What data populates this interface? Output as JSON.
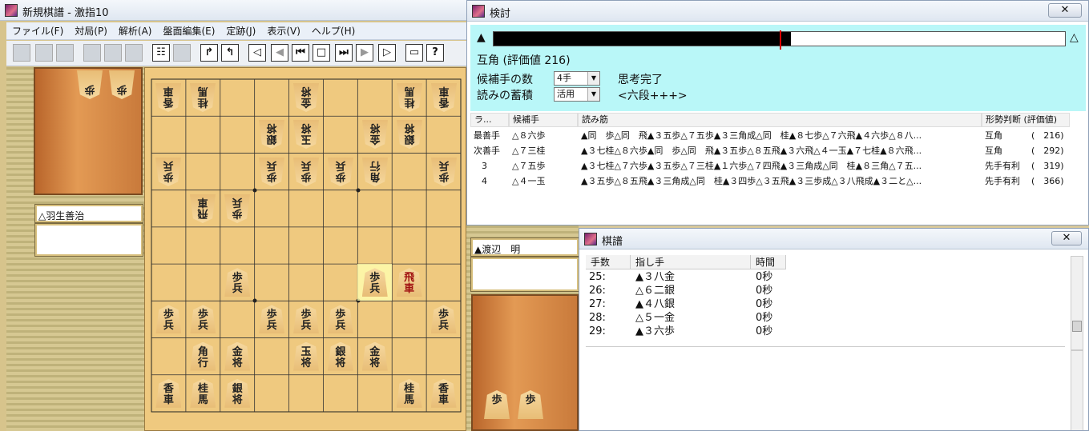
{
  "main_window": {
    "title": "新規棋譜 - 激指10",
    "menu": [
      "ファイル(F)",
      "対局(P)",
      "解析(A)",
      "盤面編集(E)",
      "定跡(J)",
      "表示(V)",
      "ヘルプ(H)"
    ]
  },
  "players": {
    "gote_name": "△羽生善治",
    "sente_name": "▲渡辺　明"
  },
  "gote_hand": [
    "歩",
    "歩"
  ],
  "sente_hand": [
    "歩",
    "歩"
  ],
  "board": {
    "gote": [
      {
        "r": 0,
        "c": 0,
        "t": "香車"
      },
      {
        "r": 0,
        "c": 1,
        "t": "桂馬"
      },
      {
        "r": 0,
        "c": 4,
        "t": "金将"
      },
      {
        "r": 0,
        "c": 7,
        "t": "桂馬"
      },
      {
        "r": 0,
        "c": 8,
        "t": "香車"
      },
      {
        "r": 1,
        "c": 3,
        "t": "銀将"
      },
      {
        "r": 1,
        "c": 4,
        "t": "玉将"
      },
      {
        "r": 1,
        "c": 6,
        "t": "金将"
      },
      {
        "r": 1,
        "c": 7,
        "t": "銀将"
      },
      {
        "r": 2,
        "c": 0,
        "t": "歩兵"
      },
      {
        "r": 2,
        "c": 3,
        "t": "歩兵"
      },
      {
        "r": 2,
        "c": 4,
        "t": "歩兵"
      },
      {
        "r": 2,
        "c": 5,
        "t": "歩兵"
      },
      {
        "r": 2,
        "c": 6,
        "t": "角行"
      },
      {
        "r": 2,
        "c": 8,
        "t": "歩兵"
      },
      {
        "r": 3,
        "c": 1,
        "t": "飛車"
      },
      {
        "r": 3,
        "c": 2,
        "t": "歩兵"
      }
    ],
    "sente": [
      {
        "r": 5,
        "c": 2,
        "t": "歩兵"
      },
      {
        "r": 5,
        "c": 6,
        "t": "歩兵",
        "hl": true
      },
      {
        "r": 5,
        "c": 7,
        "t": "飛車",
        "red": true
      },
      {
        "r": 6,
        "c": 0,
        "t": "歩兵"
      },
      {
        "r": 6,
        "c": 1,
        "t": "歩兵"
      },
      {
        "r": 6,
        "c": 3,
        "t": "歩兵"
      },
      {
        "r": 6,
        "c": 4,
        "t": "歩兵"
      },
      {
        "r": 6,
        "c": 5,
        "t": "歩兵"
      },
      {
        "r": 6,
        "c": 8,
        "t": "歩兵"
      },
      {
        "r": 7,
        "c": 1,
        "t": "角行"
      },
      {
        "r": 7,
        "c": 2,
        "t": "金将"
      },
      {
        "r": 7,
        "c": 4,
        "t": "玉将"
      },
      {
        "r": 7,
        "c": 5,
        "t": "銀将"
      },
      {
        "r": 7,
        "c": 6,
        "t": "金将"
      },
      {
        "r": 8,
        "c": 0,
        "t": "香車"
      },
      {
        "r": 8,
        "c": 1,
        "t": "桂馬"
      },
      {
        "r": 8,
        "c": 2,
        "t": "銀将"
      },
      {
        "r": 8,
        "c": 7,
        "t": "桂馬"
      },
      {
        "r": 8,
        "c": 8,
        "t": "香車"
      }
    ]
  },
  "kentou": {
    "title": "検討",
    "close": "✕",
    "left_mark": "▲",
    "right_mark": "△",
    "eval_fill": 0.52,
    "eval_marker": 0.5,
    "position_eval": "互角 (評価値 216)",
    "candidates_label": "候補手の数",
    "candidates_value": "4手",
    "status": "思考完了",
    "storage_label": "読みの蓄積",
    "storage_value": "活用",
    "level": "<六段+++>",
    "columns": [
      "ラ...",
      "候補手",
      "読み筋",
      "形勢判断 (評価値)"
    ],
    "rows": [
      {
        "rank": "最善手",
        "move": "△８六歩",
        "line": "▲同　歩△同　飛▲３五歩△７五歩▲３三角成△同　桂▲８七歩△７六飛▲４六歩△８八...",
        "judge": "互角",
        "value": "(　216)"
      },
      {
        "rank": "次善手",
        "move": "△７三桂",
        "line": "▲３七桂△８六歩▲同　歩△同　飛▲３五歩△８五飛▲３六飛△４一玉▲７七桂▲８六飛...",
        "judge": "互角",
        "value": "(　292)"
      },
      {
        "rank": "3",
        "move": "△７五歩",
        "line": "▲３七桂△７六歩▲３五歩△７三桂▲１六歩△７四飛▲３三角成△同　桂▲８三角△７五...",
        "judge": "先手有利",
        "value": "(　319)"
      },
      {
        "rank": "4",
        "move": "△４一玉",
        "line": "▲３五歩△８五飛▲３三角成△同　桂▲３四歩△３五飛▲３三歩成△３八飛成▲３二と△...",
        "judge": "先手有利",
        "value": "(　366)"
      }
    ]
  },
  "kifu": {
    "title": "棋譜",
    "close": "✕",
    "columns": [
      "手数",
      "指し手",
      "時間"
    ],
    "moves": [
      {
        "n": "25:",
        "m": "▲３八金",
        "t": "0秒"
      },
      {
        "n": "26:",
        "m": "△６二銀",
        "t": "0秒"
      },
      {
        "n": "27:",
        "m": "▲４八銀",
        "t": "0秒"
      },
      {
        "n": "28:",
        "m": "△５一金",
        "t": "0秒"
      },
      {
        "n": "29:",
        "m": "▲３六歩",
        "t": "0秒"
      }
    ]
  }
}
